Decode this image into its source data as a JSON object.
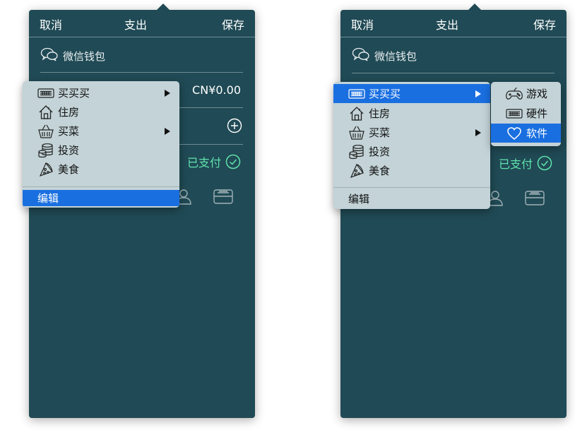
{
  "panels": [
    {
      "header": {
        "cancel": "取消",
        "title": "支出",
        "save": "保存"
      },
      "wallet": {
        "label": "微信钱包"
      },
      "amount": "CN¥0.00",
      "status": {
        "paid": "已支付"
      },
      "menu": {
        "items": [
          {
            "label": "买买买",
            "icon": "keyboard-icon",
            "has_submenu": true
          },
          {
            "label": "住房",
            "icon": "house-icon"
          },
          {
            "label": "买菜",
            "icon": "basket-icon",
            "has_submenu": true
          },
          {
            "label": "投资",
            "icon": "coins-icon"
          },
          {
            "label": "美食",
            "icon": "pizza-icon"
          }
        ],
        "edit": "编辑",
        "selected": "编辑"
      }
    },
    {
      "header": {
        "cancel": "取消",
        "title": "支出",
        "save": "保存"
      },
      "wallet": {
        "label": "微信钱包"
      },
      "status": {
        "paid": "已支付"
      },
      "menu": {
        "items": [
          {
            "label": "买买买",
            "icon": "keyboard-icon",
            "has_submenu": true
          },
          {
            "label": "住房",
            "icon": "house-icon"
          },
          {
            "label": "买菜",
            "icon": "basket-icon",
            "has_submenu": true
          },
          {
            "label": "投资",
            "icon": "coins-icon"
          },
          {
            "label": "美食",
            "icon": "pizza-icon"
          }
        ],
        "edit": "编辑",
        "selected": "买买买"
      },
      "submenu": {
        "items": [
          {
            "label": "游戏",
            "icon": "gamepad-icon"
          },
          {
            "label": "硬件",
            "icon": "keyboard-icon"
          },
          {
            "label": "软件",
            "icon": "heart-icon"
          }
        ],
        "selected": "软件"
      }
    }
  ],
  "colors": {
    "panel_bg": "#204a55",
    "menu_bg": "#c3d3d7",
    "selection": "#1a6fe0",
    "paid_green": "#5fe3ad"
  }
}
